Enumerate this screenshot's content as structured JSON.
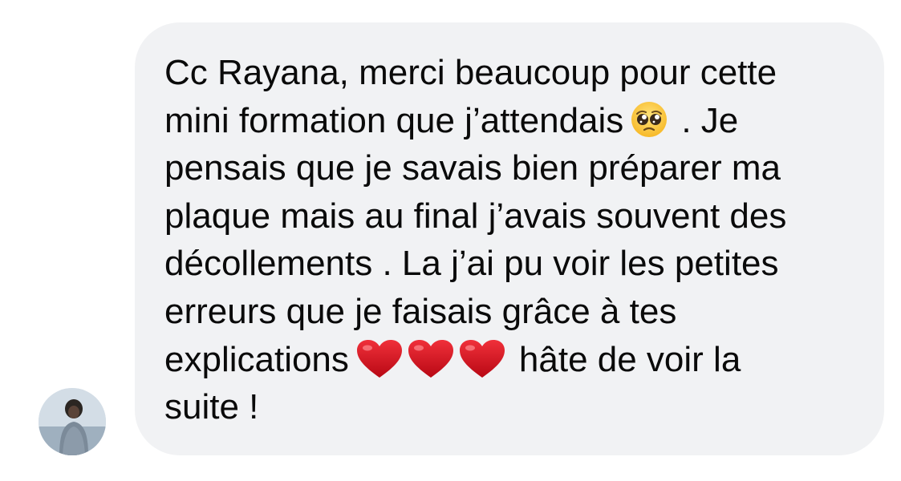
{
  "message": {
    "line1": "Cc Rayana, merci beaucoup pour cette",
    "line2_before_emoji": "mini formation que j’attendais",
    "line2_after_emoji": ". Je",
    "line3": "pensais que je savais bien préparer ma",
    "line4": "plaque mais au final j’avais souvent des",
    "line5": "décollements . La j’ai pu voir les petites",
    "line6": "erreurs que je faisais grâce à tes",
    "line7_before_emoji": "explications",
    "line7_after_emoji": "hâte de voir la",
    "line8": "suite !"
  },
  "emojis": {
    "pleading": "pleading-face-emoji",
    "heart": "red-heart-emoji",
    "heart_count": 3
  },
  "colors": {
    "bubble_background": "#f1f2f4",
    "text": "#0a0a0a",
    "heart": "#d4101c"
  }
}
